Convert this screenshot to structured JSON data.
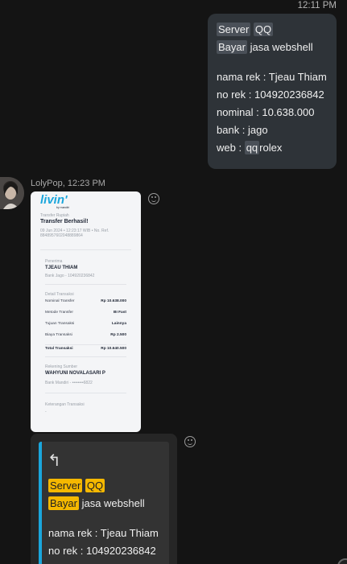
{
  "outgoing": {
    "timestamp": "12:11 PM",
    "lines": [
      {
        "parts": [
          {
            "t": "Server",
            "h": "g"
          },
          {
            "t": " ",
            "h": ""
          },
          {
            "t": "QQ",
            "h": "g"
          }
        ]
      },
      {
        "parts": [
          {
            "t": "Bayar",
            "h": "g"
          },
          {
            "t": " jasa webshell",
            "h": ""
          }
        ]
      },
      {
        "gap": true
      },
      {
        "parts": [
          {
            "t": "nama rek : Tjeau Thiam",
            "h": ""
          }
        ]
      },
      {
        "parts": [
          {
            "t": "no rek : 104920236842",
            "h": ""
          }
        ]
      },
      {
        "parts": [
          {
            "t": "nominal : 10.638.000",
            "h": ""
          }
        ]
      },
      {
        "parts": [
          {
            "t": "bank : jago",
            "h": ""
          }
        ]
      },
      {
        "parts": [
          {
            "t": "web : ",
            "h": ""
          },
          {
            "t": "qq",
            "h": "g"
          },
          {
            "t": "rolex",
            "h": ""
          }
        ]
      }
    ]
  },
  "incoming": {
    "sender": "LolyPop",
    "timestamp": "12:23 PM",
    "sender_line": "LolyPop, 12:23 PM",
    "receipt": {
      "logo": "livin'",
      "logo_sub": "by mandiri",
      "section": "Transfer Rupiah",
      "title": "Transfer Berhasil!",
      "datetime": "09 Jun 2024 • 12:23:17 WIB • No. Ref.",
      "ref": "8848957602048889864",
      "recipient_label": "Penerima",
      "recipient_name": "TJEAU THIAM",
      "recipient_bank": "Bank Jago - 104920236842",
      "detail_label": "Detail Transaksi",
      "rows": [
        {
          "k": "Nominal Transfer",
          "v": "Rp 10.638.000"
        },
        {
          "k": "Metode Transfer",
          "v": "BI Fast"
        },
        {
          "k": "Tujuan Transaksi",
          "v": "Lainnya"
        },
        {
          "k": "Biaya Transaksi",
          "v": "Rp 2.500"
        }
      ],
      "total": {
        "k": "Total Transaksi",
        "v": "Rp 10.640.500"
      },
      "source_label": "Rekening Sumber",
      "source_name": "WAHYUNI NOVALASARI P",
      "source_bank": "Bank Mandiri - ••••••••6822",
      "notes_label": "Keterangan Transaksi",
      "notes_value": "-"
    },
    "reply": {
      "arrow": "↰",
      "lines": [
        {
          "parts": [
            {
              "t": "Server",
              "h": "y"
            },
            {
              "t": " ",
              "h": ""
            },
            {
              "t": "QQ",
              "h": "y"
            }
          ]
        },
        {
          "parts": [
            {
              "t": "Bayar",
              "h": "y"
            },
            {
              "t": " jasa webshell",
              "h": ""
            }
          ]
        },
        {
          "gap": true
        },
        {
          "parts": [
            {
              "t": "nama rek : Tjeau Thiam",
              "h": ""
            }
          ]
        },
        {
          "parts": [
            {
              "t": "no rek : 104920236842",
              "h": ""
            }
          ]
        }
      ]
    }
  },
  "icons": {
    "reaction": "smiley-reaction-icon",
    "reply": "reply-arrow-icon",
    "scroll": "scroll-down-icon"
  },
  "colors": {
    "background": "#141414",
    "outgoing_bubble": "#2e3338",
    "highlight_gray": "#4a5058",
    "highlight_yellow": "#f5b800",
    "quote_bar": "#1aa6dc"
  }
}
